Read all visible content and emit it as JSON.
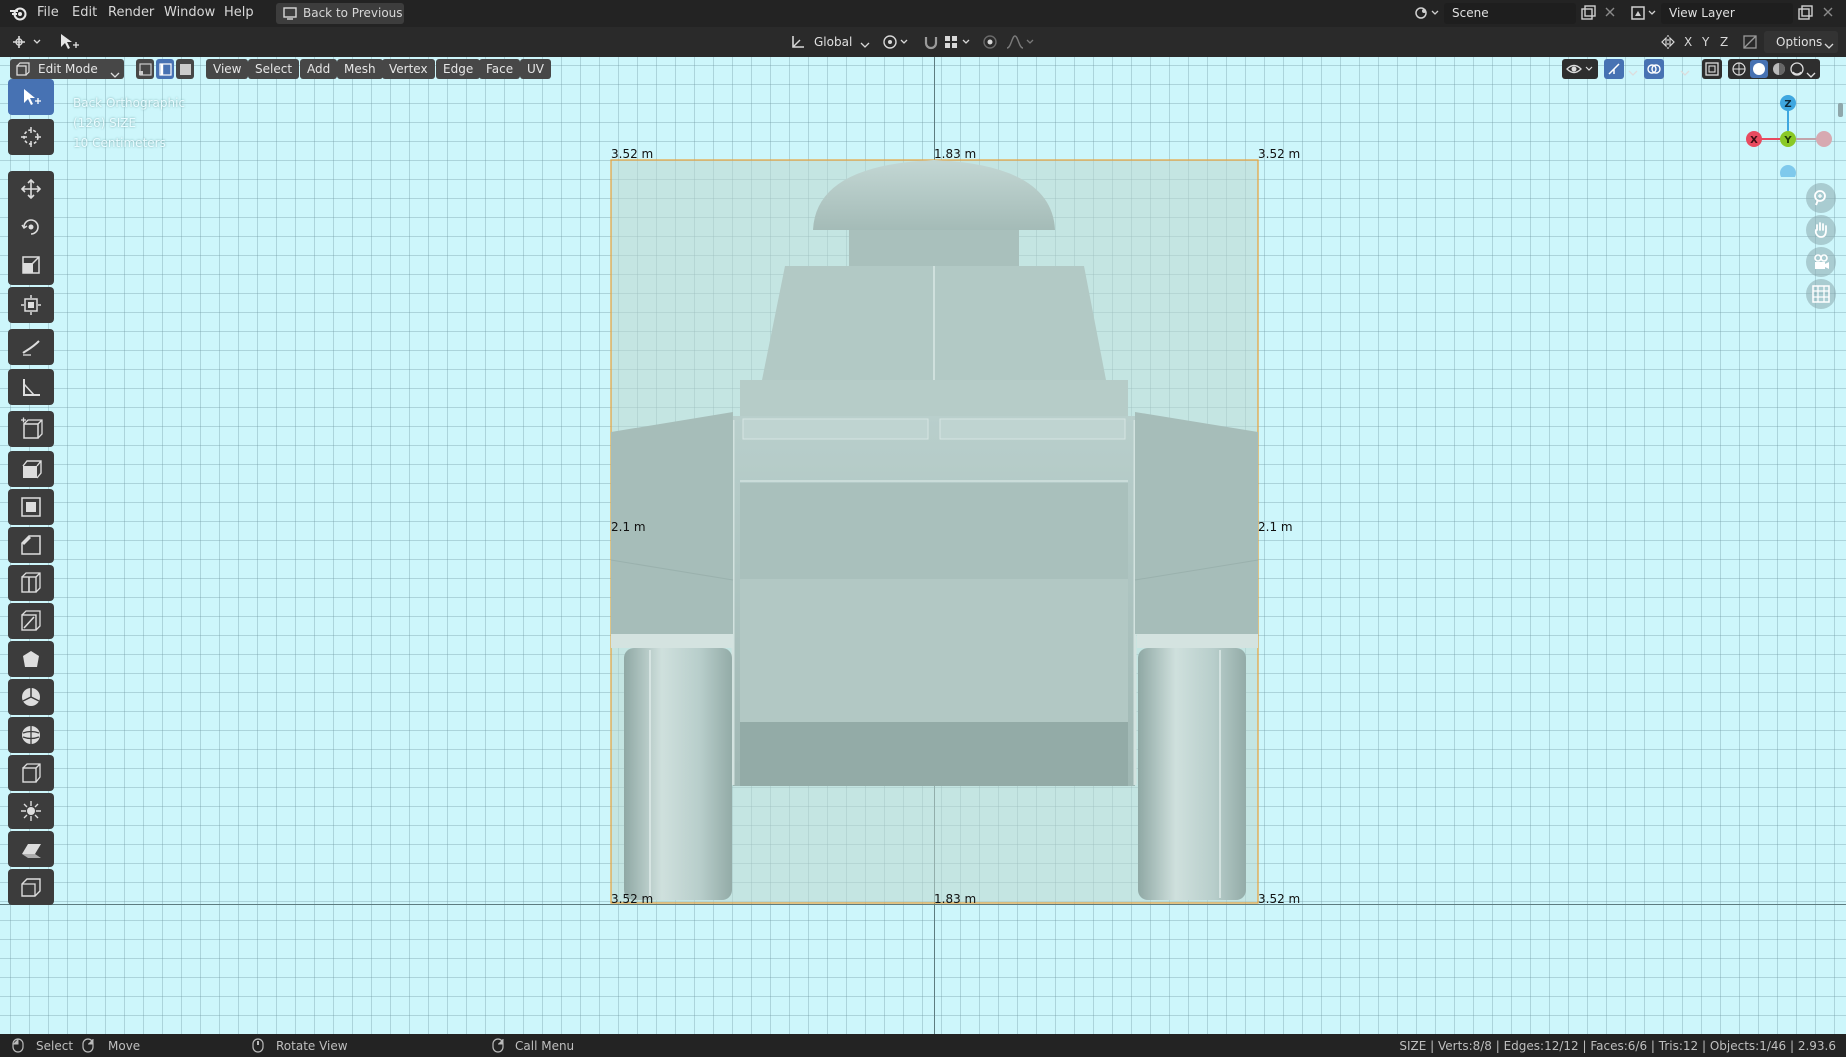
{
  "menu": {
    "file": "File",
    "edit": "Edit",
    "render": "Render",
    "window": "Window",
    "help": "Help",
    "back_to_previous": "Back to Previous"
  },
  "scene": {
    "label": "Scene",
    "view_layer": "View Layer"
  },
  "transform": {
    "orientation": "Global",
    "axis_x": "X",
    "axis_y": "Y",
    "axis_z": "Z",
    "options": "Options"
  },
  "header": {
    "mode": "Edit Mode",
    "view": "View",
    "select": "Select",
    "add": "Add",
    "mesh": "Mesh",
    "vertex": "Vertex",
    "edge": "Edge",
    "face": "Face",
    "uv": "UV"
  },
  "viewport_info": {
    "view_name": "Back Orthographic",
    "object": "(126) SIZE",
    "scale": "10 Centimeters"
  },
  "dimensions": {
    "top_left": "3.52 m",
    "top_center": "1.83 m",
    "top_right": "3.52 m",
    "mid_left": "2.1 m",
    "mid_right": "2.1 m",
    "bottom_left": "3.52 m",
    "bottom_center": "1.83 m",
    "bottom_right": "3.52 m"
  },
  "gizmo": {
    "z": "Z",
    "y": "Y",
    "x": "X"
  },
  "status": {
    "select": "Select",
    "move": "Move",
    "rotate_view": "Rotate View",
    "call_menu": "Call Menu",
    "stats": "SIZE | Verts:8/8 | Edges:12/12 | Faces:6/6 | Tris:12 | Objects:1/46 | 2.93.6"
  },
  "colors": {
    "viewport_bg": "#cdf6fb",
    "selection": "#e8a23a",
    "active_tool": "#4772b3",
    "gizmo_x": "#e84a5f",
    "gizmo_y": "#8ac926",
    "gizmo_z": "#3fa7e0"
  }
}
